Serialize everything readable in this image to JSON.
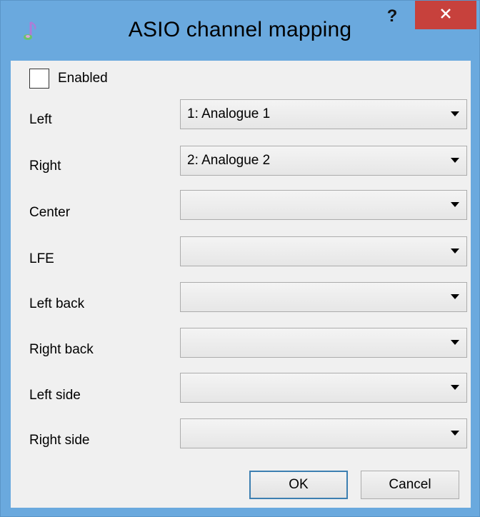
{
  "window": {
    "title": "ASIO channel mapping",
    "help_label": "?",
    "close_icon": "close-icon",
    "app_icon": "asio-app-icon"
  },
  "enabled": {
    "label": "Enabled",
    "checked": false
  },
  "channels": [
    {
      "label": "Left",
      "value": "1: Analogue 1"
    },
    {
      "label": "Right",
      "value": "2: Analogue 2"
    },
    {
      "label": "Center",
      "value": ""
    },
    {
      "label": "LFE",
      "value": ""
    },
    {
      "label": "Left back",
      "value": ""
    },
    {
      "label": "Right back",
      "value": ""
    },
    {
      "label": "Left side",
      "value": ""
    },
    {
      "label": "Right side",
      "value": ""
    }
  ],
  "buttons": {
    "ok_label": "OK",
    "cancel_label": "Cancel"
  },
  "colors": {
    "titlebar": "#6aa9de",
    "close_button": "#c7413c",
    "client_bg": "#f0f0f0",
    "default_button_border": "#3c7fb1"
  }
}
